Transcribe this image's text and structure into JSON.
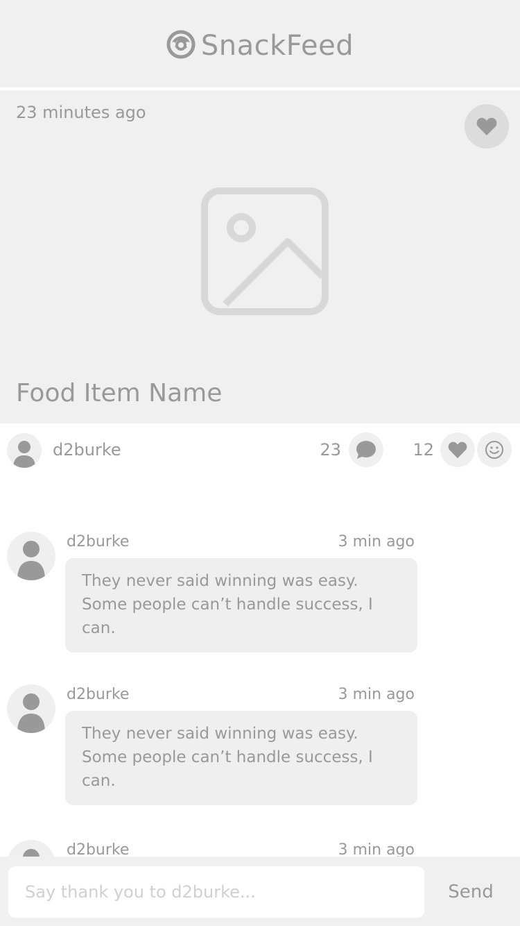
{
  "header": {
    "app_name": "SnackFeed",
    "logo_icon": "donut-icon"
  },
  "post": {
    "timestamp": "23 minutes ago",
    "food_name": "Food Item Name",
    "author": "d2burke",
    "comment_count": "23",
    "like_count": "12"
  },
  "comments": [
    {
      "user": "d2burke",
      "time": "3 min ago",
      "text": "They never said winning was easy. Some people can’t handle success, I can."
    },
    {
      "user": "d2burke",
      "time": "3 min ago",
      "text": "They never said winning was easy. Some people can’t handle success, I can."
    },
    {
      "user": "d2burke",
      "time": "3 min ago"
    }
  ],
  "composer": {
    "placeholder": "Say thank you to d2burke...",
    "send_label": "Send"
  },
  "colors": {
    "background": "#f0f0f0",
    "text": "#999999",
    "bubble": "#efefef",
    "accent": "#dcdcdc"
  }
}
